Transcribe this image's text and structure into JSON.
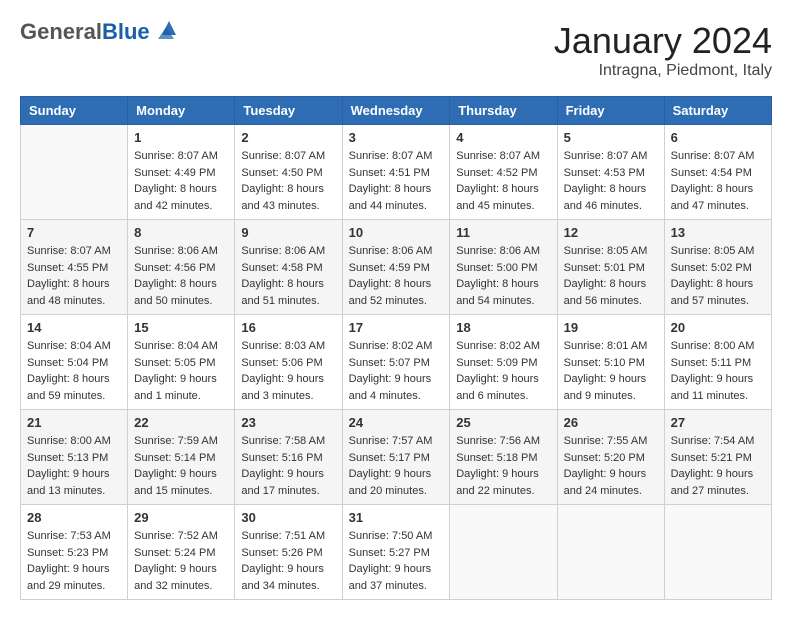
{
  "header": {
    "logo_general": "General",
    "logo_blue": "Blue",
    "month_title": "January 2024",
    "subtitle": "Intragna, Piedmont, Italy"
  },
  "days_of_week": [
    "Sunday",
    "Monday",
    "Tuesday",
    "Wednesday",
    "Thursday",
    "Friday",
    "Saturday"
  ],
  "weeks": [
    [
      {
        "day": "",
        "sunrise": "",
        "sunset": "",
        "daylight": ""
      },
      {
        "day": "1",
        "sunrise": "Sunrise: 8:07 AM",
        "sunset": "Sunset: 4:49 PM",
        "daylight": "Daylight: 8 hours and 42 minutes."
      },
      {
        "day": "2",
        "sunrise": "Sunrise: 8:07 AM",
        "sunset": "Sunset: 4:50 PM",
        "daylight": "Daylight: 8 hours and 43 minutes."
      },
      {
        "day": "3",
        "sunrise": "Sunrise: 8:07 AM",
        "sunset": "Sunset: 4:51 PM",
        "daylight": "Daylight: 8 hours and 44 minutes."
      },
      {
        "day": "4",
        "sunrise": "Sunrise: 8:07 AM",
        "sunset": "Sunset: 4:52 PM",
        "daylight": "Daylight: 8 hours and 45 minutes."
      },
      {
        "day": "5",
        "sunrise": "Sunrise: 8:07 AM",
        "sunset": "Sunset: 4:53 PM",
        "daylight": "Daylight: 8 hours and 46 minutes."
      },
      {
        "day": "6",
        "sunrise": "Sunrise: 8:07 AM",
        "sunset": "Sunset: 4:54 PM",
        "daylight": "Daylight: 8 hours and 47 minutes."
      }
    ],
    [
      {
        "day": "7",
        "sunrise": "Sunrise: 8:07 AM",
        "sunset": "Sunset: 4:55 PM",
        "daylight": "Daylight: 8 hours and 48 minutes."
      },
      {
        "day": "8",
        "sunrise": "Sunrise: 8:06 AM",
        "sunset": "Sunset: 4:56 PM",
        "daylight": "Daylight: 8 hours and 50 minutes."
      },
      {
        "day": "9",
        "sunrise": "Sunrise: 8:06 AM",
        "sunset": "Sunset: 4:58 PM",
        "daylight": "Daylight: 8 hours and 51 minutes."
      },
      {
        "day": "10",
        "sunrise": "Sunrise: 8:06 AM",
        "sunset": "Sunset: 4:59 PM",
        "daylight": "Daylight: 8 hours and 52 minutes."
      },
      {
        "day": "11",
        "sunrise": "Sunrise: 8:06 AM",
        "sunset": "Sunset: 5:00 PM",
        "daylight": "Daylight: 8 hours and 54 minutes."
      },
      {
        "day": "12",
        "sunrise": "Sunrise: 8:05 AM",
        "sunset": "Sunset: 5:01 PM",
        "daylight": "Daylight: 8 hours and 56 minutes."
      },
      {
        "day": "13",
        "sunrise": "Sunrise: 8:05 AM",
        "sunset": "Sunset: 5:02 PM",
        "daylight": "Daylight: 8 hours and 57 minutes."
      }
    ],
    [
      {
        "day": "14",
        "sunrise": "Sunrise: 8:04 AM",
        "sunset": "Sunset: 5:04 PM",
        "daylight": "Daylight: 8 hours and 59 minutes."
      },
      {
        "day": "15",
        "sunrise": "Sunrise: 8:04 AM",
        "sunset": "Sunset: 5:05 PM",
        "daylight": "Daylight: 9 hours and 1 minute."
      },
      {
        "day": "16",
        "sunrise": "Sunrise: 8:03 AM",
        "sunset": "Sunset: 5:06 PM",
        "daylight": "Daylight: 9 hours and 3 minutes."
      },
      {
        "day": "17",
        "sunrise": "Sunrise: 8:02 AM",
        "sunset": "Sunset: 5:07 PM",
        "daylight": "Daylight: 9 hours and 4 minutes."
      },
      {
        "day": "18",
        "sunrise": "Sunrise: 8:02 AM",
        "sunset": "Sunset: 5:09 PM",
        "daylight": "Daylight: 9 hours and 6 minutes."
      },
      {
        "day": "19",
        "sunrise": "Sunrise: 8:01 AM",
        "sunset": "Sunset: 5:10 PM",
        "daylight": "Daylight: 9 hours and 9 minutes."
      },
      {
        "day": "20",
        "sunrise": "Sunrise: 8:00 AM",
        "sunset": "Sunset: 5:11 PM",
        "daylight": "Daylight: 9 hours and 11 minutes."
      }
    ],
    [
      {
        "day": "21",
        "sunrise": "Sunrise: 8:00 AM",
        "sunset": "Sunset: 5:13 PM",
        "daylight": "Daylight: 9 hours and 13 minutes."
      },
      {
        "day": "22",
        "sunrise": "Sunrise: 7:59 AM",
        "sunset": "Sunset: 5:14 PM",
        "daylight": "Daylight: 9 hours and 15 minutes."
      },
      {
        "day": "23",
        "sunrise": "Sunrise: 7:58 AM",
        "sunset": "Sunset: 5:16 PM",
        "daylight": "Daylight: 9 hours and 17 minutes."
      },
      {
        "day": "24",
        "sunrise": "Sunrise: 7:57 AM",
        "sunset": "Sunset: 5:17 PM",
        "daylight": "Daylight: 9 hours and 20 minutes."
      },
      {
        "day": "25",
        "sunrise": "Sunrise: 7:56 AM",
        "sunset": "Sunset: 5:18 PM",
        "daylight": "Daylight: 9 hours and 22 minutes."
      },
      {
        "day": "26",
        "sunrise": "Sunrise: 7:55 AM",
        "sunset": "Sunset: 5:20 PM",
        "daylight": "Daylight: 9 hours and 24 minutes."
      },
      {
        "day": "27",
        "sunrise": "Sunrise: 7:54 AM",
        "sunset": "Sunset: 5:21 PM",
        "daylight": "Daylight: 9 hours and 27 minutes."
      }
    ],
    [
      {
        "day": "28",
        "sunrise": "Sunrise: 7:53 AM",
        "sunset": "Sunset: 5:23 PM",
        "daylight": "Daylight: 9 hours and 29 minutes."
      },
      {
        "day": "29",
        "sunrise": "Sunrise: 7:52 AM",
        "sunset": "Sunset: 5:24 PM",
        "daylight": "Daylight: 9 hours and 32 minutes."
      },
      {
        "day": "30",
        "sunrise": "Sunrise: 7:51 AM",
        "sunset": "Sunset: 5:26 PM",
        "daylight": "Daylight: 9 hours and 34 minutes."
      },
      {
        "day": "31",
        "sunrise": "Sunrise: 7:50 AM",
        "sunset": "Sunset: 5:27 PM",
        "daylight": "Daylight: 9 hours and 37 minutes."
      },
      {
        "day": "",
        "sunrise": "",
        "sunset": "",
        "daylight": ""
      },
      {
        "day": "",
        "sunrise": "",
        "sunset": "",
        "daylight": ""
      },
      {
        "day": "",
        "sunrise": "",
        "sunset": "",
        "daylight": ""
      }
    ]
  ]
}
